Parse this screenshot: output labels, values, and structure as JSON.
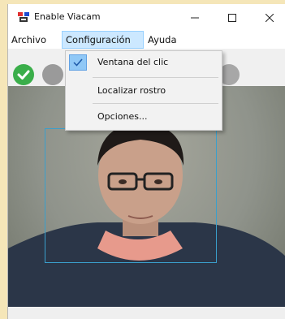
{
  "window": {
    "title": "Enable Viacam"
  },
  "titlebar": {
    "icons": [
      "app-icon",
      "minimize-icon",
      "maximize-icon",
      "close-icon"
    ]
  },
  "menubar": {
    "items": [
      {
        "label": "Archivo"
      },
      {
        "label": "Configuración",
        "active": true
      },
      {
        "label": "Ayuda"
      }
    ]
  },
  "dropdown": {
    "items": [
      {
        "label": "Ventana del clic",
        "checked": true
      },
      {
        "label": "Localizar rostro"
      },
      {
        "label": "Opciones..."
      }
    ]
  },
  "toolbar": {
    "icons": [
      "check-icon",
      "gray-circle-icon",
      "gray-circle-icon"
    ]
  },
  "colors": {
    "accent_menu": "#cce8ff",
    "check_green": "#3aae4a",
    "face_box": "#3a9fcc"
  }
}
